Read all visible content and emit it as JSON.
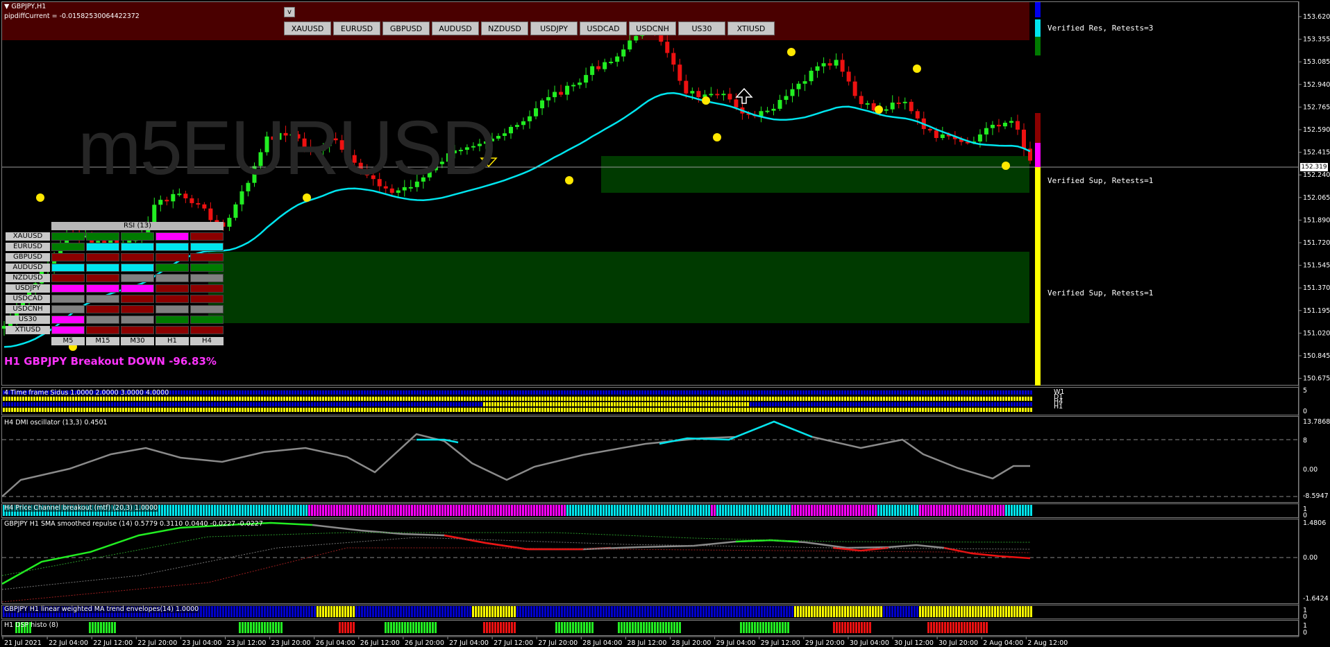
{
  "header": {
    "symbol_timeframe": "GBPJPY,H1",
    "indicator_line": "pipdiffCurrent = -0.01582530064422372",
    "toggle_label": "v"
  },
  "watermark": "m5EURUSD",
  "symbol_buttons": [
    "XAUUSD",
    "EURUSD",
    "GBPUSD",
    "AUDUSD",
    "NZDUSD",
    "USDJPY",
    "USDCAD",
    "USDCNH",
    "US30",
    "XTIUSD"
  ],
  "zones": {
    "resistance": "Verified Res, Retests=3",
    "support_1": "Verified Sup, Retests=1",
    "support_2": "Verified Sup, Retests=1"
  },
  "rsi_panel": {
    "title": "RSI (13)",
    "symbols": [
      "XAUUSD",
      "EURUSD",
      "GBPUSD",
      "AUDUSD",
      "NZDUSD",
      "USDJPY",
      "USDCAD",
      "USDCNH",
      "US30",
      "XTIUSD"
    ],
    "timeframes": [
      "M5",
      "M15",
      "M30",
      "H1",
      "H4"
    ],
    "cells": [
      [
        "#007a00",
        "#007a00",
        "#007a00",
        "#ff00ff",
        "#8b0000"
      ],
      [
        "#007a00",
        "#00e5ee",
        "#00e5ee",
        "#00e5ee",
        "#00e5ee"
      ],
      [
        "#8b0000",
        "#8b0000",
        "#8b0000",
        "#8b0000",
        "#8b0000"
      ],
      [
        "#00e5ee",
        "#00e5ee",
        "#00e5ee",
        "#007a00",
        "#007a00"
      ],
      [
        "#8b0000",
        "#8b0000",
        "#808080",
        "#808080",
        "#808080"
      ],
      [
        "#ff00ff",
        "#ff00ff",
        "#ff00ff",
        "#8b0000",
        "#8b0000"
      ],
      [
        "#808080",
        "#808080",
        "#8b0000",
        "#8b0000",
        "#8b0000"
      ],
      [
        "#808080",
        "#8b0000",
        "#8b0000",
        "#808080",
        "#808080"
      ],
      [
        "#ff00ff",
        "#808080",
        "#808080",
        "#007a00",
        "#007a00"
      ],
      [
        "#ff00ff",
        "#8b0000",
        "#8b0000",
        "#8b0000",
        "#8b0000"
      ]
    ]
  },
  "breakout_text": "H1 GBPJPY Breakout DOWN -96.83%",
  "price_axis": {
    "labels": [
      "153.620",
      "153.355",
      "153.085",
      "152.940",
      "152.765",
      "152.590",
      "152.415",
      "152.240",
      "152.065",
      "151.890",
      "151.720",
      "151.545",
      "151.370",
      "151.195",
      "151.020",
      "150.845",
      "150.675"
    ],
    "current_price": "152.319"
  },
  "time_axis": {
    "labels": [
      "21 Jul 2021",
      "22 Jul 04:00",
      "22 Jul 12:00",
      "22 Jul 20:00",
      "23 Jul 04:00",
      "23 Jul 12:00",
      "23 Jul 20:00",
      "26 Jul 04:00",
      "26 Jul 12:00",
      "26 Jul 20:00",
      "27 Jul 04:00",
      "27 Jul 12:00",
      "27 Jul 20:00",
      "28 Jul 04:00",
      "28 Jul 12:00",
      "28 Jul 20:00",
      "29 Jul 04:00",
      "29 Jul 12:00",
      "29 Jul 20:00",
      "30 Jul 04:00",
      "30 Jul 12:00",
      "30 Jul 20:00",
      "2 Aug 04:00",
      "2 Aug 12:00"
    ]
  },
  "panels": {
    "sidus": {
      "label": "4 Time frame Sidus 1.0000 2.0000 3.0000 4.0000",
      "scale_top": "5",
      "scale_bottom": "0",
      "tf_labels": [
        "W1",
        "D1",
        "H4",
        "H1"
      ]
    },
    "dmi": {
      "label": "H4 DMI oscillator (13,3) 0.4501",
      "scale": [
        "13.7868",
        "8",
        "0.00",
        "-8.5947"
      ]
    },
    "channel": {
      "label": "H4 Price Channel breakout (mtf) (20,3) 1.0000",
      "scale_top": "1",
      "scale_bottom": "0"
    },
    "repulse": {
      "label": "GBPJPY H1 SMA smoothed repulse (14) 0.5779 0.3110 0.0440 -0.0227 -0.0227",
      "scale": [
        "1.4806",
        "0.00",
        "-1.6424"
      ]
    },
    "envelopes": {
      "label": "GBPJPY H1 linear weighted MA trend envelopes(14) 1.0000",
      "scale_top": "1",
      "scale_bottom": "0"
    },
    "dsp": {
      "label": "H1 DSP histo (8)",
      "scale_top": "1",
      "scale_bottom": "0"
    }
  },
  "colors": {
    "bull": "#22ee22",
    "bear": "#ee1111",
    "neutral": "#8a7a10",
    "ma_line": "#00e5ee",
    "res_zone": "#4a0000",
    "sup_zone": "#003a00",
    "magenta": "#ff00ff",
    "yellow": "#ffff00",
    "blue": "#0000cc"
  }
}
